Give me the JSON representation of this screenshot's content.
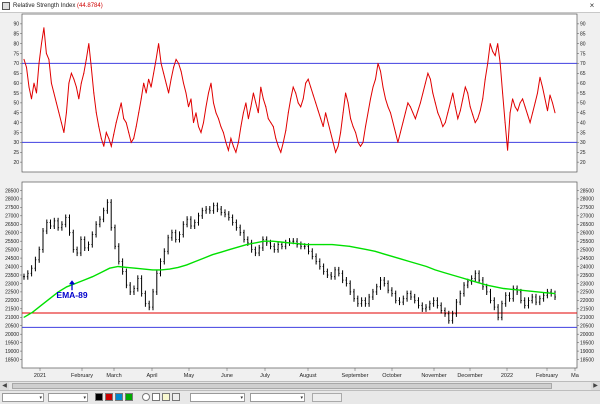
{
  "window": {
    "title": "Relative Strength Index",
    "title_value": "(44.8784)",
    "close_label": "×"
  },
  "colors": {
    "rsi_line": "#e00000",
    "rsi_levels": "#4040e0",
    "price_bars": "#000000",
    "ema_line": "#00e000",
    "support_line": "#e00000",
    "level_line": "#4040e0",
    "annotation": "#0000cc"
  },
  "annotation": {
    "text": "EMA-89",
    "icon": "up-arrow-icon"
  },
  "x_axis": {
    "labels": [
      "2021",
      "February",
      "March",
      "April",
      "May",
      "June",
      "July",
      "August",
      "September",
      "October",
      "November",
      "December",
      "2022",
      "February",
      "Ma"
    ]
  },
  "chart_data": [
    {
      "type": "line",
      "title": "Relative Strength Index",
      "current_value": 44.8784,
      "ylim": [
        15,
        95
      ],
      "yticks": [
        20,
        25,
        30,
        35,
        40,
        45,
        50,
        55,
        60,
        65,
        70,
        75,
        80,
        85,
        90
      ],
      "levels": [
        30,
        70
      ],
      "series": [
        {
          "name": "Relative Strength Index",
          "values": [
            72,
            68,
            58,
            52,
            60,
            55,
            70,
            80,
            88,
            75,
            72,
            60,
            55,
            50,
            45,
            40,
            35,
            45,
            60,
            65,
            62,
            58,
            52,
            60,
            65,
            72,
            80,
            68,
            55,
            45,
            38,
            32,
            28,
            35,
            32,
            28,
            34,
            40,
            45,
            50,
            42,
            40,
            35,
            30,
            32,
            38,
            45,
            52,
            60,
            55,
            62,
            58,
            65,
            72,
            80,
            70,
            65,
            60,
            55,
            62,
            68,
            72,
            70,
            66,
            60,
            55,
            48,
            52,
            40,
            45,
            38,
            35,
            40,
            48,
            55,
            60,
            50,
            45,
            42,
            38,
            35,
            30,
            26,
            32,
            28,
            25,
            30,
            38,
            45,
            50,
            42,
            48,
            55,
            50,
            45,
            58,
            52,
            48,
            42,
            40,
            38,
            32,
            28,
            25,
            30,
            36,
            45,
            52,
            58,
            55,
            50,
            48,
            52,
            60,
            62,
            58,
            54,
            50,
            46,
            42,
            38,
            45,
            40,
            35,
            30,
            25,
            28,
            35,
            45,
            55,
            50,
            42,
            38,
            35,
            30,
            28,
            30,
            38,
            45,
            52,
            58,
            62,
            70,
            66,
            58,
            52,
            48,
            45,
            40,
            35,
            30,
            35,
            40,
            45,
            50,
            48,
            45,
            42,
            46,
            50,
            55,
            60,
            65,
            62,
            55,
            50,
            45,
            42,
            38,
            40,
            45,
            50,
            55,
            48,
            42,
            46,
            52,
            58,
            55,
            48,
            44,
            40,
            42,
            46,
            52,
            62,
            70,
            80,
            76,
            74,
            80,
            70,
            55,
            40,
            26,
            45,
            52,
            48,
            46,
            50,
            52,
            48,
            44,
            40,
            45,
            50,
            55,
            63,
            58,
            52,
            46,
            54,
            50,
            45
          ]
        }
      ]
    },
    {
      "type": "line",
      "title": "",
      "ylim": [
        18000,
        29000
      ],
      "yticks": [
        18500,
        19000,
        19500,
        20000,
        20500,
        21000,
        21500,
        22000,
        22500,
        23000,
        23500,
        24000,
        24500,
        25000,
        25500,
        26000,
        26500,
        27000,
        27500,
        28000,
        28500
      ],
      "levels": [
        {
          "value": 21250,
          "color": "#e00000"
        },
        {
          "value": 20400,
          "color": "#4040e0"
        }
      ],
      "series": [
        {
          "name": "Price",
          "values": [
            23400,
            23600,
            23900,
            24400,
            25000,
            26100,
            26600,
            26400,
            26700,
            26300,
            26500,
            26900,
            26000,
            25000,
            24800,
            25600,
            25100,
            25300,
            25900,
            26500,
            26800,
            27300,
            27800,
            26300,
            25200,
            24300,
            23700,
            22900,
            22500,
            22700,
            23300,
            22400,
            21800,
            21600,
            22500,
            23600,
            24300,
            24900,
            25700,
            26000,
            25600,
            25900,
            26500,
            26800,
            26400,
            26600,
            27000,
            27300,
            27400,
            27300,
            27600,
            27400,
            27200,
            27100,
            26900,
            26600,
            26300,
            26000,
            25600,
            25400,
            25000,
            24800,
            25100,
            25600,
            25400,
            25200,
            25000,
            25300,
            25200,
            25400,
            25500,
            25500,
            25300,
            25200,
            25200,
            24900,
            24600,
            24300,
            24000,
            23700,
            23500,
            23400,
            23800,
            23600,
            23200,
            23000,
            22500,
            22100,
            21800,
            22000,
            21800,
            22200,
            22500,
            22800,
            23200,
            23000,
            22600,
            22400,
            22000,
            21900,
            22100,
            22400,
            22200,
            22000,
            21700,
            21500,
            21600,
            21800,
            22000,
            21700,
            21400,
            21200,
            20800,
            21200,
            21900,
            22400,
            22900,
            23100,
            23300,
            23600,
            23200,
            22800,
            22500,
            22000,
            21600,
            21000,
            21800,
            22300,
            22100,
            22700,
            22500,
            22000,
            21700,
            22000,
            22200,
            21900,
            22100,
            22300,
            22500,
            22400,
            22200
          ]
        },
        {
          "name": "EMA-89",
          "values": [
            21000,
            21300,
            21700,
            22100,
            22500,
            22800,
            23000,
            23200,
            23400,
            23650,
            23900,
            24000,
            23950,
            23900,
            23850,
            23800,
            23800,
            23850,
            23950,
            24100,
            24300,
            24500,
            24700,
            24850,
            25000,
            25150,
            25300,
            25400,
            25500,
            25500,
            25450,
            25400,
            25350,
            25300,
            25300,
            25300,
            25300,
            25250,
            25200,
            25100,
            25000,
            24900,
            24750,
            24600,
            24450,
            24300,
            24150,
            24000,
            23800,
            23650,
            23500,
            23350,
            23200,
            23050,
            22900,
            22800,
            22700,
            22650,
            22600,
            22550,
            22500,
            22450,
            22400
          ]
        }
      ]
    }
  ]
}
